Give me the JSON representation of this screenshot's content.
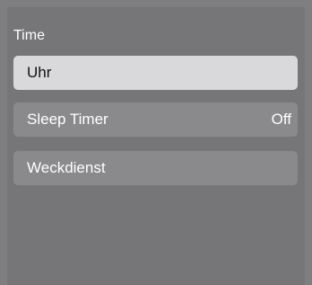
{
  "section": {
    "title": "Time"
  },
  "items": [
    {
      "label": "Uhr",
      "value": ""
    },
    {
      "label": "Sleep Timer",
      "value": "Off"
    },
    {
      "label": "Weckdienst",
      "value": ""
    }
  ]
}
